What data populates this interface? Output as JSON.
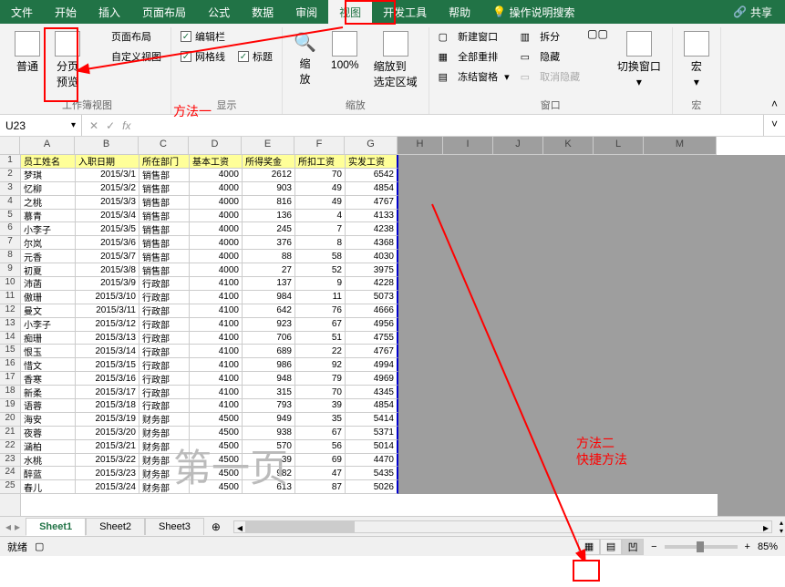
{
  "menubar": {
    "items": [
      "文件",
      "开始",
      "插入",
      "页面布局",
      "公式",
      "数据",
      "审阅",
      "视图",
      "开发工具",
      "帮助"
    ],
    "active_index": 7,
    "tell_me": "操作说明搜索",
    "share": "共享"
  },
  "ribbon": {
    "groups": [
      {
        "label": "工作簿视图",
        "items": [
          {
            "type": "large",
            "label": "普通"
          },
          {
            "type": "large",
            "label": "分页\n预览"
          },
          {
            "type": "small-col",
            "items": [
              "页面布局",
              "自定义视图"
            ]
          }
        ]
      },
      {
        "label": "显示",
        "items": [
          {
            "type": "check-col",
            "items": [
              {
                "label": "编辑栏",
                "checked": true
              },
              {
                "label": "网格线",
                "checked": true
              },
              {
                "label": "标题",
                "checked": true
              }
            ]
          }
        ]
      },
      {
        "label": "缩放",
        "items": [
          {
            "type": "large",
            "label": "缩\n放"
          },
          {
            "type": "large",
            "label": "100%"
          },
          {
            "type": "large",
            "label": "缩放到\n选定区域"
          }
        ]
      },
      {
        "label": "窗口",
        "items": [
          {
            "type": "small-col",
            "items": [
              "新建窗口",
              "全部重排",
              "冻结窗格"
            ]
          },
          {
            "type": "small-col",
            "items": [
              "拆分",
              "隐藏",
              "取消隐藏"
            ]
          },
          {
            "type": "large",
            "label": "切换窗口"
          }
        ]
      },
      {
        "label": "宏",
        "items": [
          {
            "type": "large",
            "label": "宏"
          }
        ]
      }
    ]
  },
  "formula_bar": {
    "name_box": "U23",
    "fx": "fx"
  },
  "sheet": {
    "columns": [
      "A",
      "B",
      "C",
      "D",
      "E",
      "F",
      "G",
      "H",
      "I",
      "J",
      "K",
      "L",
      "M"
    ],
    "header": [
      "员工姓名",
      "入职日期",
      "所在部门",
      "基本工资",
      "所得奖金",
      "所扣工资",
      "实发工资"
    ],
    "rows": [
      [
        "梦琪",
        "2015/3/1",
        "销售部",
        "4000",
        "2612",
        "70",
        "6542"
      ],
      [
        "忆柳",
        "2015/3/2",
        "销售部",
        "4000",
        "903",
        "49",
        "4854"
      ],
      [
        "之桃",
        "2015/3/3",
        "销售部",
        "4000",
        "816",
        "49",
        "4767"
      ],
      [
        "慕青",
        "2015/3/4",
        "销售部",
        "4000",
        "136",
        "4",
        "4133"
      ],
      [
        "小李子",
        "2015/3/5",
        "销售部",
        "4000",
        "245",
        "7",
        "4238"
      ],
      [
        "尔岚",
        "2015/3/6",
        "销售部",
        "4000",
        "376",
        "8",
        "4368"
      ],
      [
        "元香",
        "2015/3/7",
        "销售部",
        "4000",
        "88",
        "58",
        "4030"
      ],
      [
        "初夏",
        "2015/3/8",
        "销售部",
        "4000",
        "27",
        "52",
        "3975"
      ],
      [
        "沛菡",
        "2015/3/9",
        "行政部",
        "4100",
        "137",
        "9",
        "4228"
      ],
      [
        "傲珊",
        "2015/3/10",
        "行政部",
        "4100",
        "984",
        "11",
        "5073"
      ],
      [
        "曼文",
        "2015/3/11",
        "行政部",
        "4100",
        "642",
        "76",
        "4666"
      ],
      [
        "小李子",
        "2015/3/12",
        "行政部",
        "4100",
        "923",
        "67",
        "4956"
      ],
      [
        "痴珊",
        "2015/3/13",
        "行政部",
        "4100",
        "706",
        "51",
        "4755"
      ],
      [
        "恨玉",
        "2015/3/14",
        "行政部",
        "4100",
        "689",
        "22",
        "4767"
      ],
      [
        "惜文",
        "2015/3/15",
        "行政部",
        "4100",
        "986",
        "92",
        "4994"
      ],
      [
        "香寒",
        "2015/3/16",
        "行政部",
        "4100",
        "948",
        "79",
        "4969"
      ],
      [
        "新柔",
        "2015/3/17",
        "行政部",
        "4100",
        "315",
        "70",
        "4345"
      ],
      [
        "语蓉",
        "2015/3/18",
        "行政部",
        "4100",
        "793",
        "39",
        "4854"
      ],
      [
        "海安",
        "2015/3/19",
        "财务部",
        "4500",
        "949",
        "35",
        "5414"
      ],
      [
        "夜蓉",
        "2015/3/20",
        "财务部",
        "4500",
        "938",
        "67",
        "5371"
      ],
      [
        "涵柏",
        "2015/3/21",
        "财务部",
        "4500",
        "570",
        "56",
        "5014"
      ],
      [
        "水桃",
        "2015/3/22",
        "财务部",
        "4500",
        "39",
        "69",
        "4470"
      ],
      [
        "醉蓝",
        "2015/3/23",
        "财务部",
        "4500",
        "982",
        "47",
        "5435"
      ],
      [
        "春儿",
        "2015/3/24",
        "财务部",
        "4500",
        "613",
        "87",
        "5026"
      ]
    ],
    "watermark": "第一页"
  },
  "tabs": {
    "items": [
      "Sheet1",
      "Sheet2",
      "Sheet3"
    ],
    "active_index": 0
  },
  "status": {
    "ready": "就绪",
    "zoom": "85%"
  },
  "annotations": {
    "method1": "方法一",
    "method2_line1": "方法二",
    "method2_line2": "快捷方法"
  }
}
